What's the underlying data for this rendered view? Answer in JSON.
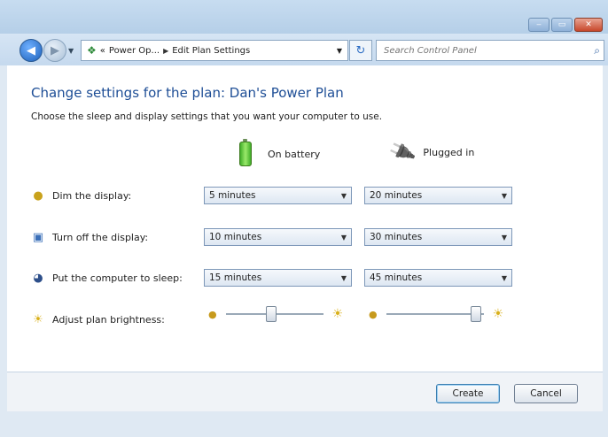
{
  "window": {
    "controls": {
      "minimize": "‒",
      "maximize": "▭",
      "close": "✕"
    }
  },
  "nav": {
    "back_icon": "back-arrow-icon",
    "forward_icon": "forward-arrow-icon",
    "breadcrumb": [
      "Power Op...",
      "Edit Plan Settings"
    ],
    "breadcrumb_prefix": "«",
    "search_placeholder": "Search Control Panel"
  },
  "page": {
    "heading": "Change settings for the plan: Dan's Power Plan",
    "subtitle": "Choose the sleep and display settings that you want your computer to use.",
    "columns": {
      "battery": "On battery",
      "plugged": "Plugged in"
    }
  },
  "settings": [
    {
      "label": "Dim the display:",
      "icon": "dim-display-icon",
      "battery": "5 minutes",
      "plugged": "20 minutes"
    },
    {
      "label": "Turn off the display:",
      "icon": "monitor-icon",
      "battery": "10 minutes",
      "plugged": "30 minutes"
    },
    {
      "label": "Put the computer to sleep:",
      "icon": "sleep-moon-icon",
      "battery": "15 minutes",
      "plugged": "45 minutes"
    }
  ],
  "brightness": {
    "label": "Adjust plan brightness:",
    "battery_level": 0.45,
    "plugged_level": 0.95
  },
  "buttons": {
    "create": "Create",
    "cancel": "Cancel"
  },
  "colors": {
    "heading": "#1e4e96",
    "accent": "#2b6cc4"
  }
}
